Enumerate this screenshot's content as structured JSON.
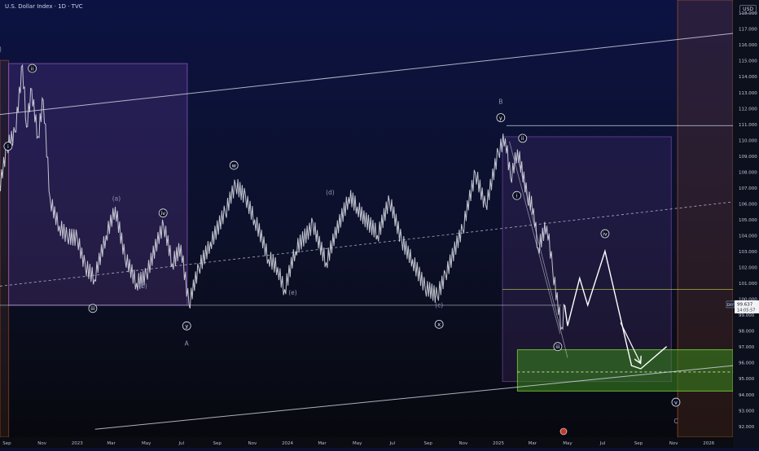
{
  "header": {
    "title": "U.S. Dollar Index · 1D · TVC",
    "currency": "USD"
  },
  "price_label": {
    "symbol": "DXY",
    "value": "99.637",
    "countdown": "14:05:57"
  },
  "colors": {
    "background_top": "#0c1342",
    "background_bottom": "#080a12",
    "channel": "#d8dbe8",
    "zone_green": "#3a8a1e",
    "purple_box": "#9b59d0",
    "orange_box": "#c0602a",
    "forecast": "#ffffff"
  },
  "chart_data": {
    "type": "line",
    "title": "U.S. Dollar Index",
    "xlabel": "",
    "ylabel": "",
    "ylim": [
      92.0,
      119.0
    ],
    "x_ticks": [
      "Sep",
      "Nov",
      "2023",
      "Mar",
      "May",
      "Jul",
      "Sep",
      "Nov",
      "2024",
      "Mar",
      "May",
      "Jul",
      "Sep",
      "Nov",
      "2025",
      "Mar",
      "May",
      "Jul",
      "Sep",
      "Nov",
      "2026"
    ],
    "y_ticks": [
      118.0,
      117.0,
      116.0,
      115.0,
      114.0,
      113.0,
      112.0,
      111.0,
      110.0,
      109.0,
      108.0,
      107.0,
      106.0,
      105.0,
      104.0,
      103.0,
      102.0,
      101.0,
      100.0,
      99.0,
      98.0,
      97.0,
      96.0,
      95.0,
      94.0,
      93.0,
      92.0
    ],
    "series": [
      {
        "values": [
          [
            "2022-08-15",
            106.0
          ],
          [
            "2022-09-01",
            109.5
          ],
          [
            "2022-09-15",
            110.5
          ],
          [
            "2022-09-28",
            114.7
          ],
          [
            "2022-10-05",
            110.8
          ],
          [
            "2022-10-14",
            113.2
          ],
          [
            "2022-10-25",
            110.2
          ],
          [
            "2022-11-03",
            112.5
          ],
          [
            "2022-11-15",
            106.3
          ],
          [
            "2022-12-01",
            104.6
          ],
          [
            "2022-12-15",
            103.8
          ],
          [
            "2023-01-01",
            103.9
          ],
          [
            "2023-01-15",
            102.1
          ],
          [
            "2023-01-31",
            101.2
          ],
          [
            "2023-02-20",
            104.0
          ],
          [
            "2023-03-08",
            105.8
          ],
          [
            "2023-03-25",
            102.5
          ],
          [
            "2023-04-14",
            101.0
          ],
          [
            "2023-05-01",
            101.6
          ],
          [
            "2023-05-31",
            104.6
          ],
          [
            "2023-06-15",
            102.2
          ],
          [
            "2023-06-30",
            103.4
          ],
          [
            "2023-07-14",
            99.6
          ],
          [
            "2023-07-31",
            101.9
          ],
          [
            "2023-08-20",
            103.6
          ],
          [
            "2023-09-15",
            105.4
          ],
          [
            "2023-10-03",
            107.1
          ],
          [
            "2023-10-20",
            106.5
          ],
          [
            "2023-11-05",
            105.0
          ],
          [
            "2023-11-29",
            102.5
          ],
          [
            "2023-12-15",
            102.0
          ],
          [
            "2023-12-27",
            100.6
          ],
          [
            "2024-01-15",
            103.0
          ],
          [
            "2024-02-14",
            104.8
          ],
          [
            "2024-03-08",
            102.3
          ],
          [
            "2024-04-16",
            106.4
          ],
          [
            "2024-05-01",
            105.8
          ],
          [
            "2024-06-05",
            104.0
          ],
          [
            "2024-06-26",
            106.1
          ],
          [
            "2024-07-17",
            103.7
          ],
          [
            "2024-08-05",
            102.5
          ],
          [
            "2024-08-27",
            100.6
          ],
          [
            "2024-09-17",
            100.2
          ],
          [
            "2024-10-01",
            101.6
          ],
          [
            "2024-10-31",
            104.3
          ],
          [
            "2024-11-22",
            107.9
          ],
          [
            "2024-12-10",
            105.9
          ],
          [
            "2025-01-01",
            109.2
          ],
          [
            "2025-01-13",
            110.1
          ],
          [
            "2025-01-22",
            107.6
          ],
          [
            "2025-02-03",
            109.4
          ],
          [
            "2025-02-20",
            106.4
          ],
          [
            "2025-03-03",
            105.7
          ],
          [
            "2025-03-11",
            103.2
          ],
          [
            "2025-03-26",
            104.6
          ],
          [
            "2025-04-05",
            101.9
          ],
          [
            "2025-04-21",
            98.2
          ],
          [
            "2025-04-26",
            99.6
          ]
        ]
      },
      {
        "values": [
          [
            "2025-04-26",
            99.6
          ],
          [
            "2025-05-01",
            98.3
          ],
          [
            "2025-05-22",
            101.3
          ],
          [
            "2025-06-05",
            99.6
          ],
          [
            "2025-07-05",
            103.0
          ],
          [
            "2025-08-20",
            95.8
          ],
          [
            "2025-09-05",
            95.6
          ],
          [
            "2025-10-20",
            97.0
          ]
        ]
      }
    ],
    "annotations": [
      {
        "text": "(A)",
        "x": "2022-08-15",
        "y": 115.7,
        "style": "plain"
      },
      {
        "text": "ii",
        "x": "2022-10-15",
        "y": 114.5,
        "style": "circle"
      },
      {
        "text": "i",
        "x": "2022-09-03",
        "y": 109.6,
        "style": "circle"
      },
      {
        "text": "iii",
        "x": "2023-01-28",
        "y": 99.4,
        "style": "circle"
      },
      {
        "text": "iv",
        "x": "2023-05-30",
        "y": 105.4,
        "style": "circle"
      },
      {
        "text": "y",
        "x": "2023-07-10",
        "y": 98.3,
        "style": "circle"
      },
      {
        "text": "A",
        "x": "2023-07-10",
        "y": 97.2,
        "style": "plain"
      },
      {
        "text": "w",
        "x": "2023-09-30",
        "y": 108.4,
        "style": "circle"
      },
      {
        "text": "(a)",
        "x": "2023-03-10",
        "y": 106.3,
        "style": "plain"
      },
      {
        "text": "(b)",
        "x": "2023-04-25",
        "y": 100.8,
        "style": "plain"
      },
      {
        "text": "(d)",
        "x": "2024-03-15",
        "y": 106.7,
        "style": "plain"
      },
      {
        "text": "(e)",
        "x": "2024-01-10",
        "y": 100.4,
        "style": "plain"
      },
      {
        "text": "x",
        "x": "2024-09-20",
        "y": 98.4,
        "style": "circle"
      },
      {
        "text": "(c)",
        "x": "2024-09-20",
        "y": 99.6,
        "style": "plain"
      },
      {
        "text": "B",
        "x": "2025-01-05",
        "y": 112.4,
        "style": "plain"
      },
      {
        "text": "y",
        "x": "2025-01-05",
        "y": 111.4,
        "style": "circle"
      },
      {
        "text": "ii",
        "x": "2025-02-12",
        "y": 110.1,
        "style": "circle"
      },
      {
        "text": "i",
        "x": "2025-02-02",
        "y": 106.5,
        "style": "circle"
      },
      {
        "text": "iii",
        "x": "2025-04-14",
        "y": 97.0,
        "style": "circle"
      },
      {
        "text": "iv",
        "x": "2025-07-05",
        "y": 104.1,
        "style": "circle"
      },
      {
        "text": "v",
        "x": "2025-11-05",
        "y": 93.5,
        "style": "circle"
      },
      {
        "text": "C",
        "x": "2025-11-05",
        "y": 92.3,
        "style": "plain"
      }
    ]
  }
}
